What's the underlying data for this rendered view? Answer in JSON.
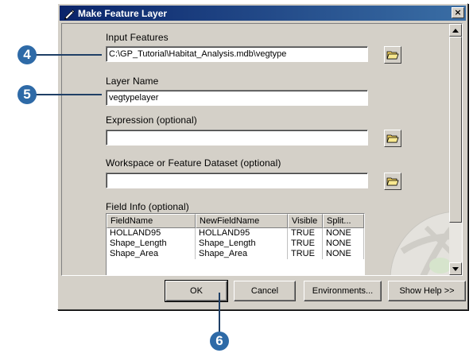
{
  "dialog": {
    "title": "Make Feature Layer",
    "close_label": "×"
  },
  "form": {
    "input_features": {
      "label": "Input Features",
      "value": "C:\\GP_Tutorial\\Habitat_Analysis.mdb\\vegtype"
    },
    "layer_name": {
      "label": "Layer Name",
      "value": "vegtypelayer"
    },
    "expression": {
      "label": "Expression (optional)",
      "value": ""
    },
    "workspace": {
      "label": "Workspace or Feature Dataset (optional)",
      "value": ""
    },
    "field_info": {
      "label": "Field Info (optional)",
      "columns": [
        "FieldName",
        "NewFieldName",
        "Visible",
        "Split..."
      ],
      "rows": [
        [
          "HOLLAND95",
          "HOLLAND95",
          "TRUE",
          "NONE"
        ],
        [
          "Shape_Length",
          "Shape_Length",
          "TRUE",
          "NONE"
        ],
        [
          "Shape_Area",
          "Shape_Area",
          "TRUE",
          "NONE"
        ]
      ]
    }
  },
  "buttons": {
    "ok": "OK",
    "cancel": "Cancel",
    "environments": "Environments...",
    "show_help": "Show Help >>"
  },
  "callouts": {
    "step4": "4",
    "step5": "5",
    "step6": "6"
  },
  "icons": {
    "title": "pencil-icon",
    "browse": "open-folder-icon",
    "scroll_up": "arrow-up-icon",
    "scroll_down": "arrow-down-icon"
  },
  "colors": {
    "titlebar": "#0a246a",
    "callout": "#2e6aa7",
    "face": "#d4d0c8"
  }
}
